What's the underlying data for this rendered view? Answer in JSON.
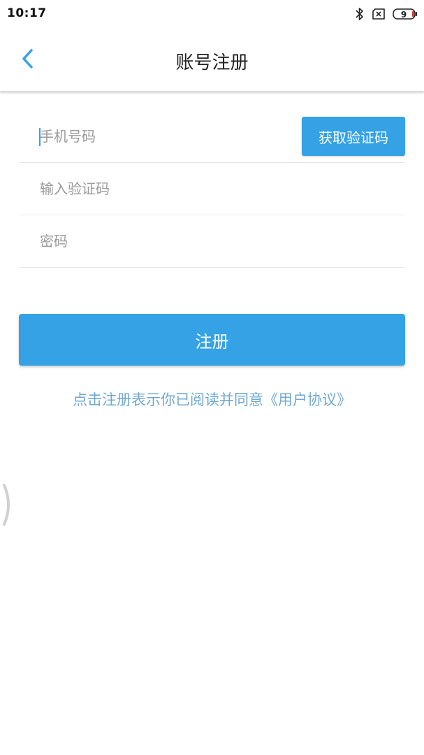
{
  "status_bar": {
    "time": "10:17",
    "icons": [
      "bluetooth-icon",
      "sim-off-icon",
      "battery-icon"
    ],
    "battery_level": "9"
  },
  "header": {
    "title": "账号注册",
    "back_icon": "chevron-left-icon"
  },
  "form": {
    "phone_placeholder": "手机号码",
    "get_code_label": "获取验证码",
    "code_placeholder": "输入验证码",
    "password_placeholder": "密码"
  },
  "actions": {
    "register_label": "注册",
    "agreement_text": "点击注册表示你已阅读并同意《用户协议》"
  },
  "colors": {
    "accent": "#35a2e6",
    "link": "#6fa8cf",
    "placeholder": "#9a9a9a",
    "divider": "#e6e6e6"
  }
}
